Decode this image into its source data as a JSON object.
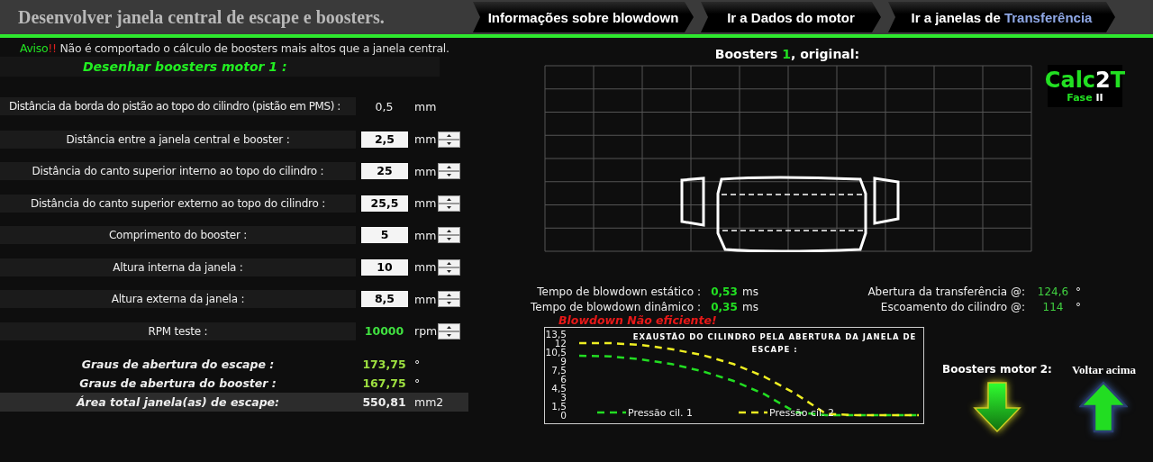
{
  "header": {
    "title": "Desenvolver janela central de escape e boosters.",
    "nav": [
      {
        "segments": [
          {
            "text": "Informações sobre blowdown",
            "kind": "plain"
          }
        ]
      },
      {
        "segments": [
          {
            "text": "Ir a Dados do motor",
            "kind": "plain"
          }
        ]
      },
      {
        "segments": [
          {
            "text": "Ir a janelas de ",
            "kind": "plain"
          },
          {
            "text": "Transferência",
            "kind": "link"
          }
        ]
      }
    ]
  },
  "warning": [
    {
      "text": "Aviso",
      "kind": "green"
    },
    {
      "text": "!!",
      "kind": "red"
    },
    {
      "text": " Não é comportado o cálculo de boosters mais altos que a janela central.",
      "kind": "plain"
    }
  ],
  "section_title": "Desenhar boosters motor 1 :",
  "params": [
    {
      "label": "Distância da borda do pistão ao topo do cilindro (pistão em PMS) :",
      "value": "0,5",
      "unit": "mm",
      "kind": "readout",
      "spinner": false
    },
    {
      "label": "Distância entre a janela central e booster :",
      "value": "2,5",
      "unit": "mm",
      "kind": "input",
      "spinner": true
    },
    {
      "label": "Distância do canto superior interno ao topo do cilindro :",
      "value": "25",
      "unit": "mm",
      "kind": "input",
      "spinner": true
    },
    {
      "label": "Distância do canto superior externo ao topo do cilindro :",
      "value": "25,5",
      "unit": "mm",
      "kind": "input",
      "spinner": true
    },
    {
      "label": "Comprimento do booster :",
      "value": "5",
      "unit": "mm",
      "kind": "input",
      "spinner": true
    },
    {
      "label": "Altura interna da janela :",
      "value": "10",
      "unit": "mm",
      "kind": "input",
      "spinner": true
    },
    {
      "label": "Altura externa da janela :",
      "value": "8,5",
      "unit": "mm",
      "kind": "input",
      "spinner": true
    },
    {
      "label": "RPM teste :",
      "value": "10000",
      "unit": "rpm",
      "kind": "green",
      "spinner": true
    }
  ],
  "results": [
    {
      "label": "Graus de abertura do escape :",
      "value": "173,75",
      "unit": "°",
      "kind": "green"
    },
    {
      "label": "Graus de abertura do booster :",
      "value": "167,75",
      "unit": "°",
      "kind": "green"
    },
    {
      "label": "Área total janela(as) de escape:",
      "value": "550,81",
      "unit": "mm2",
      "kind": "total"
    }
  ],
  "preview": {
    "title": [
      {
        "text": "Boosters ",
        "kind": "plain"
      },
      {
        "text": "1",
        "kind": "green"
      },
      {
        "text": ", original:",
        "kind": "plain"
      }
    ]
  },
  "logo": {
    "name": [
      {
        "text": "Calc",
        "kind": "green"
      },
      {
        "text": "2",
        "kind": "white"
      },
      {
        "text": "T",
        "kind": "green"
      }
    ],
    "subtitle": [
      {
        "text": "Fase ",
        "kind": "green"
      },
      {
        "text": "II",
        "kind": "white"
      }
    ]
  },
  "blowdown": [
    {
      "label": "Tempo de blowdown estático :",
      "value": "0,53",
      "unit": "ms"
    },
    {
      "label": "Tempo de blowdown dinâmico :",
      "value": "0,35",
      "unit": "ms"
    }
  ],
  "ports": [
    {
      "label": "Abertura da transferência @:",
      "value": "124,6",
      "unit": "°"
    },
    {
      "label": "Escoamento do cilindro @:",
      "value": "114",
      "unit": "°"
    }
  ],
  "blowdown_status": "Blowdown Não eficiente!",
  "exhaust_chart": {
    "chart_data": {
      "type": "line",
      "title": "EXAUSTÃO DO CILINDRO PELA ABERTURA DA JANELA DE ESCAPE :",
      "ylim": [
        0,
        13.5
      ],
      "legend": true,
      "yticks": [
        {
          "value": 0,
          "label": "0"
        },
        {
          "value": 1.5,
          "label": "1,5"
        },
        {
          "value": 3,
          "label": "3"
        },
        {
          "value": 4.5,
          "label": "4,5"
        },
        {
          "value": 6,
          "label": "6"
        },
        {
          "value": 7.5,
          "label": "7,5"
        },
        {
          "value": 9,
          "label": "9"
        },
        {
          "value": 10.5,
          "label": "10,5"
        },
        {
          "value": 12,
          "label": "12"
        },
        {
          "value": 13.5,
          "label": "13,5"
        }
      ],
      "series": [
        {
          "name": "Pressão cil. 1",
          "color": "#22dd22",
          "line_style": "dashed",
          "values": [
            9.9,
            9.8,
            9.3,
            8.5,
            7.3,
            5.7,
            3.5,
            0.5,
            0,
            0,
            0,
            0
          ]
        },
        {
          "name": "Pressão cil. 2",
          "color": "#eeee22",
          "line_style": "dashed",
          "values": [
            12,
            12,
            11.7,
            11,
            10,
            8.5,
            6.4,
            3.6,
            0.2,
            0,
            0,
            0
          ]
        }
      ]
    }
  },
  "arrows": [
    {
      "label": "Boosters motor 2:",
      "kind": "down"
    },
    {
      "label": "Voltar acima",
      "kind": "up"
    }
  ]
}
